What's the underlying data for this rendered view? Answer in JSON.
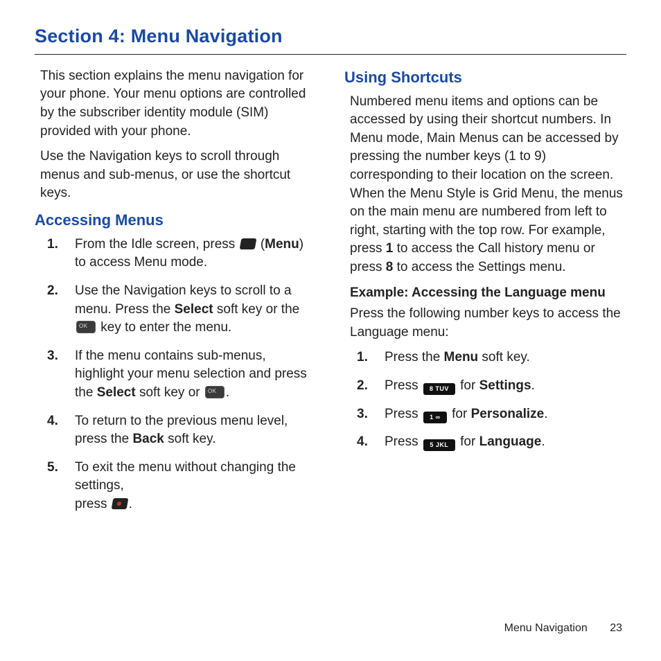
{
  "section_title": "Section 4: Menu Navigation",
  "intro": {
    "p1": "This section explains the menu navigation for your phone. Your menu options are controlled by the subscriber identity module (SIM) provided with your phone.",
    "p2": "Use the Navigation keys to scroll through menus and sub-menus, or use the shortcut keys."
  },
  "accessing": {
    "heading": "Accessing Menus",
    "steps": {
      "s1": {
        "num": "1.",
        "pre": "From the Idle screen, press ",
        "post_open": " (",
        "menu_bold": "Menu",
        "post_close": ") to access Menu mode."
      },
      "s2": {
        "num": "2.",
        "pre": "Use the Navigation keys to scroll to a menu. Press the ",
        "select_bold": "Select",
        "mid": " soft key or the ",
        "post": " key to enter the menu."
      },
      "s3": {
        "num": "3.",
        "pre": "If the menu contains sub-menus, highlight your menu selection and press the ",
        "select_bold": "Select",
        "mid": " soft key or ",
        "post": "."
      },
      "s4": {
        "num": "4.",
        "pre": "To return to the previous menu level, press the ",
        "back_bold": "Back",
        "post": " soft key."
      },
      "s5": {
        "num": "5.",
        "pre": "To exit the menu without changing the settings,",
        "line2_pre": "press ",
        "post": "."
      }
    }
  },
  "shortcuts": {
    "heading": "Using Shortcuts",
    "para_a": "Numbered menu items and options can be accessed by using their shortcut numbers. In Menu mode, Main Menus can be accessed by pressing the number keys (1 to 9) corresponding to their location on the screen. When the Menu Style is Grid Menu, the menus on the main menu are numbered from left to right, starting with the top row. For example, press ",
    "bold_1": "1",
    "para_b": " to access the Call history menu or press ",
    "bold_8": "8",
    "para_c": " to access the Settings menu.",
    "example_head": "Example: Accessing the Language menu",
    "example_intro": "Press the following number keys to access the Language menu:",
    "steps": {
      "s1": {
        "num": "1.",
        "pre": "Press the ",
        "bold": "Menu",
        "post": " soft key."
      },
      "s2": {
        "num": "2.",
        "pre": "Press ",
        "key_label": "8 TUV",
        "mid": " for ",
        "bold": "Settings",
        "post": "."
      },
      "s3": {
        "num": "3.",
        "pre": "Press ",
        "key_label": "1 ∞",
        "mid": " for ",
        "bold": "Personalize",
        "post": "."
      },
      "s4": {
        "num": "4.",
        "pre": "Press ",
        "key_label": "5 JKL",
        "mid": " for ",
        "bold": "Language",
        "post": "."
      }
    }
  },
  "footer": {
    "label": "Menu Navigation",
    "page": "23"
  }
}
